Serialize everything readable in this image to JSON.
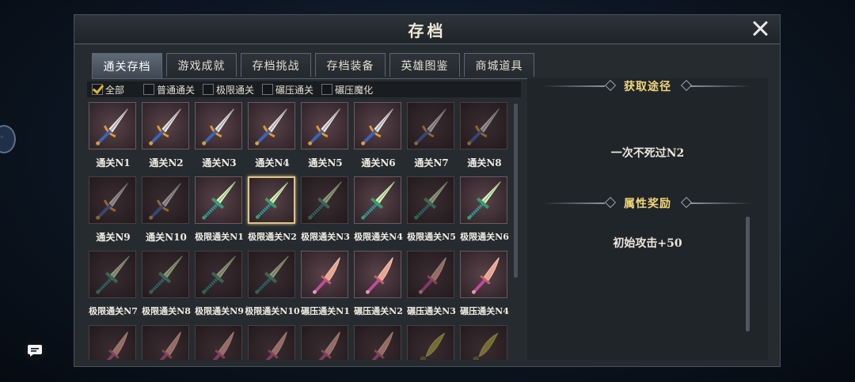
{
  "header": {
    "title": "存档"
  },
  "tabs": [
    {
      "label": "通关存档",
      "active": true
    },
    {
      "label": "游戏成就",
      "active": false
    },
    {
      "label": "存档挑战",
      "active": false
    },
    {
      "label": "存档装备",
      "active": false
    },
    {
      "label": "英雄图鉴",
      "active": false
    },
    {
      "label": "商城道具",
      "active": false
    }
  ],
  "filters": [
    {
      "label": "全部",
      "checked": true
    },
    {
      "label": "普通通关",
      "checked": false
    },
    {
      "label": "极限通关",
      "checked": false
    },
    {
      "label": "碾压通关",
      "checked": false
    },
    {
      "label": "碾压魔化",
      "checked": false
    }
  ],
  "items": [
    {
      "label": "通关N1",
      "weapon": "blue-sword-icon",
      "unlocked": true
    },
    {
      "label": "通关N2",
      "weapon": "blue-sword-icon",
      "unlocked": true
    },
    {
      "label": "通关N3",
      "weapon": "blue-sword-icon",
      "unlocked": true
    },
    {
      "label": "通关N4",
      "weapon": "blue-sword-icon",
      "unlocked": true
    },
    {
      "label": "通关N5",
      "weapon": "blue-sword-icon",
      "unlocked": true
    },
    {
      "label": "通关N6",
      "weapon": "blue-sword-icon",
      "unlocked": true
    },
    {
      "label": "通关N7",
      "weapon": "blue-sword-icon",
      "unlocked": false
    },
    {
      "label": "通关N8",
      "weapon": "blue-sword-icon",
      "unlocked": false
    },
    {
      "label": "通关N9",
      "weapon": "blue-sword-icon",
      "unlocked": false
    },
    {
      "label": "通关N10",
      "weapon": "blue-sword-icon",
      "unlocked": false
    },
    {
      "label": "极限通关N1",
      "weapon": "jade-sword-icon",
      "unlocked": true
    },
    {
      "label": "极限通关N2",
      "weapon": "jade-sword-icon",
      "unlocked": true,
      "selected": true
    },
    {
      "label": "极限通关N3",
      "weapon": "jade-sword-icon",
      "unlocked": false
    },
    {
      "label": "极限通关N4",
      "weapon": "jade-sword-icon",
      "unlocked": true
    },
    {
      "label": "极限通关N5",
      "weapon": "jade-sword-icon",
      "unlocked": false
    },
    {
      "label": "极限通关N6",
      "weapon": "jade-sword-icon",
      "unlocked": true
    },
    {
      "label": "极限通关N7",
      "weapon": "jade-sword-icon",
      "unlocked": false
    },
    {
      "label": "极限通关N8",
      "weapon": "jade-sword-icon",
      "unlocked": false
    },
    {
      "label": "极限通关N9",
      "weapon": "jade-sword-icon",
      "unlocked": false
    },
    {
      "label": "极限通关N10",
      "weapon": "jade-sword-icon",
      "unlocked": false
    },
    {
      "label": "碾压通关N1",
      "weapon": "rose-dagger-icon",
      "unlocked": true
    },
    {
      "label": "碾压通关N2",
      "weapon": "rose-dagger-icon",
      "unlocked": true
    },
    {
      "label": "碾压通关N3",
      "weapon": "rose-dagger-icon",
      "unlocked": false
    },
    {
      "label": "碾压通关N4",
      "weapon": "rose-dagger-icon",
      "unlocked": true
    },
    {
      "label": "",
      "weapon": "rose-dagger-icon",
      "unlocked": false
    },
    {
      "label": "",
      "weapon": "rose-dagger-icon",
      "unlocked": false
    },
    {
      "label": "",
      "weapon": "rose-dagger-icon",
      "unlocked": false
    },
    {
      "label": "",
      "weapon": "rose-dagger-icon",
      "unlocked": false
    },
    {
      "label": "",
      "weapon": "rose-dagger-icon",
      "unlocked": false
    },
    {
      "label": "",
      "weapon": "rose-dagger-icon",
      "unlocked": false
    },
    {
      "label": "",
      "weapon": "gold-blade-icon",
      "unlocked": false
    },
    {
      "label": "",
      "weapon": "gold-blade-icon",
      "unlocked": false
    }
  ],
  "detail": {
    "source_heading": "获取途径",
    "source_text": "一次不死过N2",
    "reward_heading": "属性奖励",
    "reward_text": "初始攻击+50"
  },
  "colors": {
    "accent_gold": "#f1d67a",
    "check_gold": "#e4b628",
    "selected_border": "#e0c58a"
  }
}
